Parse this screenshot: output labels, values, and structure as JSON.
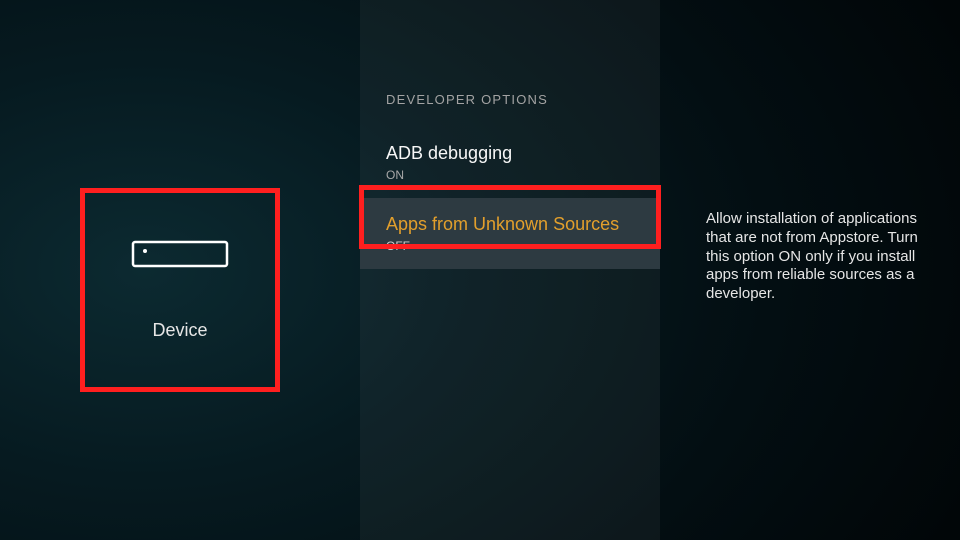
{
  "colors": {
    "highlight_border": "#ff1f1f",
    "accent_text": "#e29f2c",
    "selected_bg": "#2d3a41"
  },
  "left": {
    "label": "Device",
    "icon": "device-set-top-box-icon"
  },
  "section_title": "DEVELOPER OPTIONS",
  "options": [
    {
      "label": "ADB debugging",
      "value": "ON",
      "selected": false
    },
    {
      "label": "Apps from Unknown Sources",
      "value": "OFF",
      "selected": true
    }
  ],
  "description": "Allow installation of applications that are not from Appstore. Turn this option ON only if you install apps from reliable sources as a developer."
}
